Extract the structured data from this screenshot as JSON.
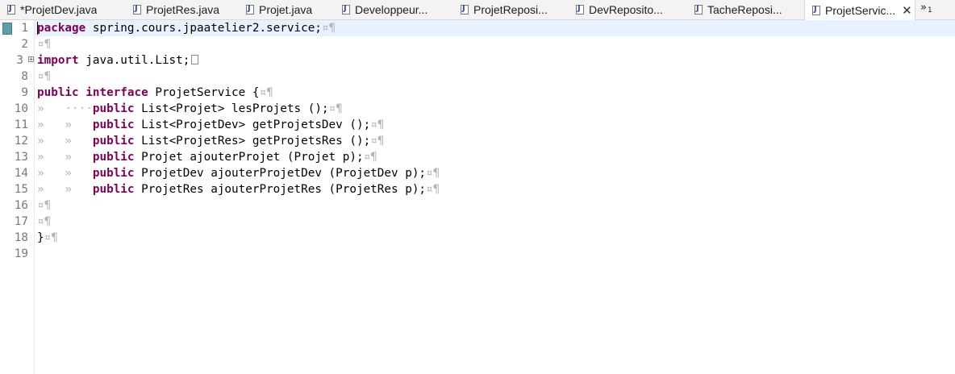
{
  "tabs": [
    {
      "label": "*ProjetDev.java"
    },
    {
      "label": "ProjetRes.java"
    },
    {
      "label": "Projet.java"
    },
    {
      "label": "Developpeur..."
    },
    {
      "label": "ProjetReposi..."
    },
    {
      "label": "DevReposito..."
    },
    {
      "label": "TacheReposi..."
    },
    {
      "label": "ProjetServic...",
      "active": true
    }
  ],
  "overflow": {
    "symbol": "»",
    "count": "1"
  },
  "editor": {
    "line_numbers": [
      "1",
      "2",
      "3",
      "8",
      "9",
      "10",
      "11",
      "12",
      "13",
      "14",
      "15",
      "16",
      "17",
      "18",
      "19"
    ],
    "lines": [
      {
        "kw": "package",
        "text": " spring.cours.jpaatelier2.service;",
        "ws": "¤¶"
      },
      {
        "ws": "¤¶"
      },
      {
        "kw": "import",
        "text": " java.util.List;"
      },
      {
        "ws": "¤¶"
      },
      {
        "kw": "public",
        "kw2": "interface",
        "text": " ProjetService {",
        "ws": "¤¶"
      },
      {
        "indent": "»   ····",
        "kw": "public",
        "text": " List<Projet> lesProjets ();",
        "ws": "¤¶"
      },
      {
        "indent": "»   »   ",
        "kw": "public",
        "text": " List<ProjetDev> getProjetsDev ();",
        "ws": "¤¶"
      },
      {
        "indent": "»   »   ",
        "kw": "public",
        "text": " List<ProjetRes> getProjetsRes ();",
        "ws": "¤¶"
      },
      {
        "indent": "»   »   ",
        "kw": "public",
        "text": " Projet ajouterProjet (Projet p);",
        "ws": "¤¶"
      },
      {
        "indent": "»   »   ",
        "kw": "public",
        "text": " ProjetDev ajouterProjetDev (ProjetDev p);",
        "ws": "¤¶"
      },
      {
        "indent": "»   »   ",
        "kw": "public",
        "text": " ProjetRes ajouterProjetRes (ProjetRes p);",
        "ws": "¤¶"
      },
      {
        "ws": "¤¶"
      },
      {
        "ws": "¤¶"
      },
      {
        "text": "}",
        "ws": "¤¶"
      },
      {}
    ]
  },
  "colors": {
    "keyword": "#7f0055",
    "whitespace_marker": "#b4b4b4",
    "line_number": "#787878",
    "current_line": "#e8f2fe"
  }
}
